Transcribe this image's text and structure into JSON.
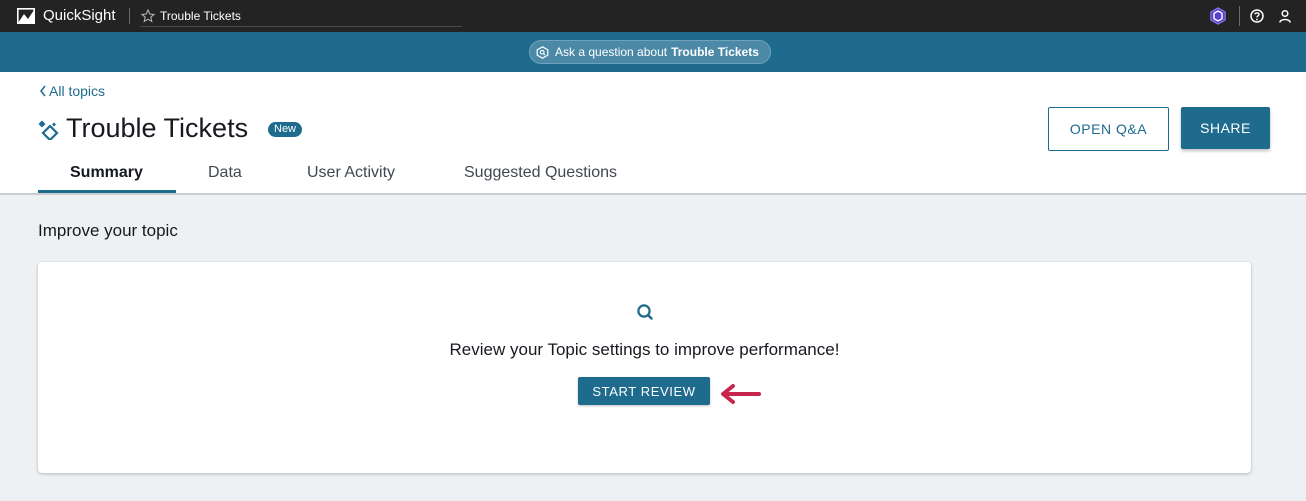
{
  "topbar": {
    "app_name": "QuickSight",
    "tab_title": "Trouble Tickets",
    "icons": [
      "quicksight-logo-icon",
      "star-icon",
      "hexagon-badge-icon",
      "help-icon",
      "user-icon"
    ]
  },
  "askbar": {
    "prefix": "Ask a question about",
    "topic": "Trouble Tickets",
    "icon": "ask-question-icon"
  },
  "header": {
    "back_link": "All topics",
    "title": "Trouble Tickets",
    "badge": "New",
    "open_qa": "OPEN Q&A",
    "share": "SHARE",
    "tabs": [
      {
        "label": "Summary",
        "active": true
      },
      {
        "label": "Data",
        "active": false
      },
      {
        "label": "User Activity",
        "active": false
      },
      {
        "label": "Suggested Questions",
        "active": false
      }
    ]
  },
  "main": {
    "section_title": "Improve your topic",
    "card": {
      "message": "Review your Topic settings to improve performance!",
      "button": "START REVIEW",
      "icon": "search-icon"
    }
  },
  "colors": {
    "topbar_bg": "#232323",
    "accent": "#1e6b8e",
    "page_bg": "#eef1f4",
    "annotation_arrow": "#c7254e"
  }
}
